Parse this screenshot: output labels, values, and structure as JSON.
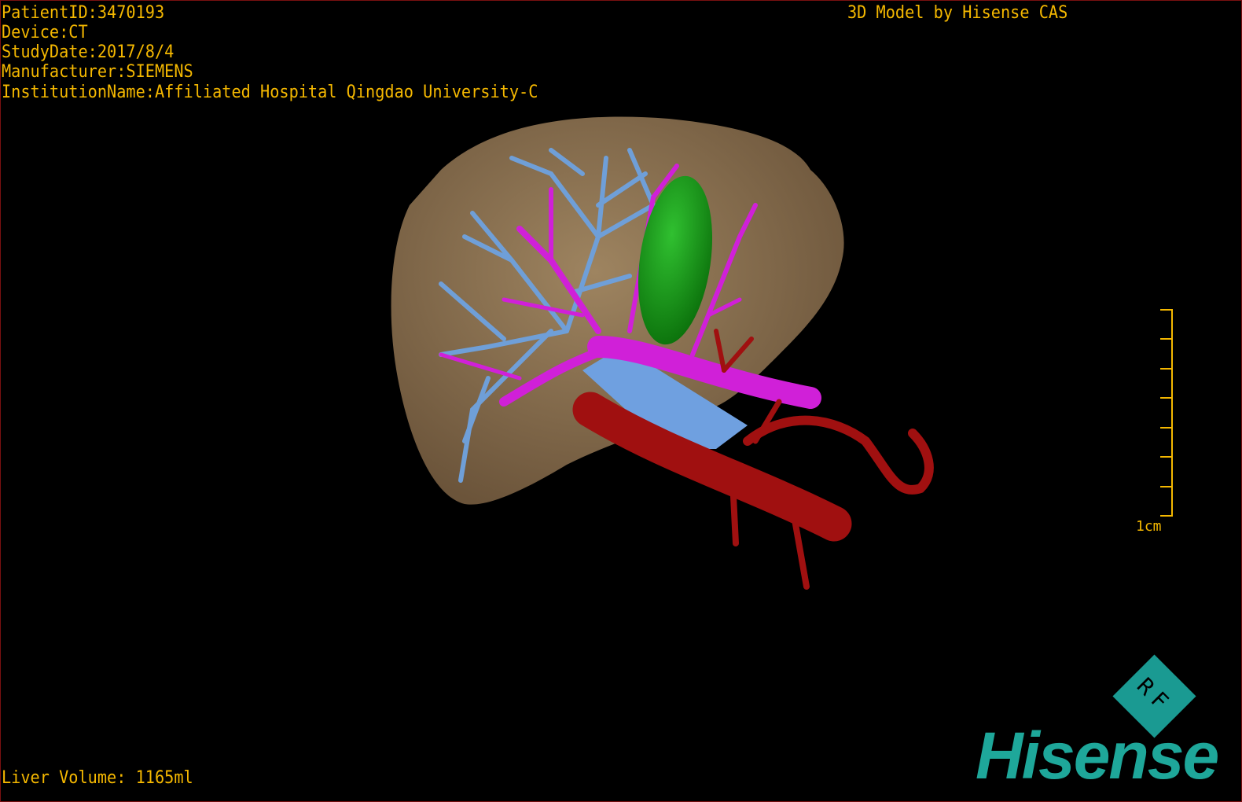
{
  "overlay": {
    "patient_id": "PatientID:3470193",
    "device": "Device:CT",
    "study_date": "StudyDate:2017/8/4",
    "manufacturer": "Manufacturer:SIEMENS",
    "institution": "InstitutionName:Affiliated Hospital Qingdao University-C",
    "title": "3D Model by Hisense CAS",
    "liver_volume": "Liver Volume: 1165ml"
  },
  "scale_bar": {
    "label": "1cm",
    "color": "#f5b800"
  },
  "logo": {
    "brand": "Hisense",
    "badge": "RF",
    "color": "#1ea79a"
  },
  "colors": {
    "liver": "#8a6e4e",
    "hepatic_vein": "#6f9fd8",
    "portal_vein": "#d020d8",
    "artery": "#a01010",
    "tumor": "#109010",
    "ivc": "#6fa0e0",
    "text": "#f5b800"
  }
}
